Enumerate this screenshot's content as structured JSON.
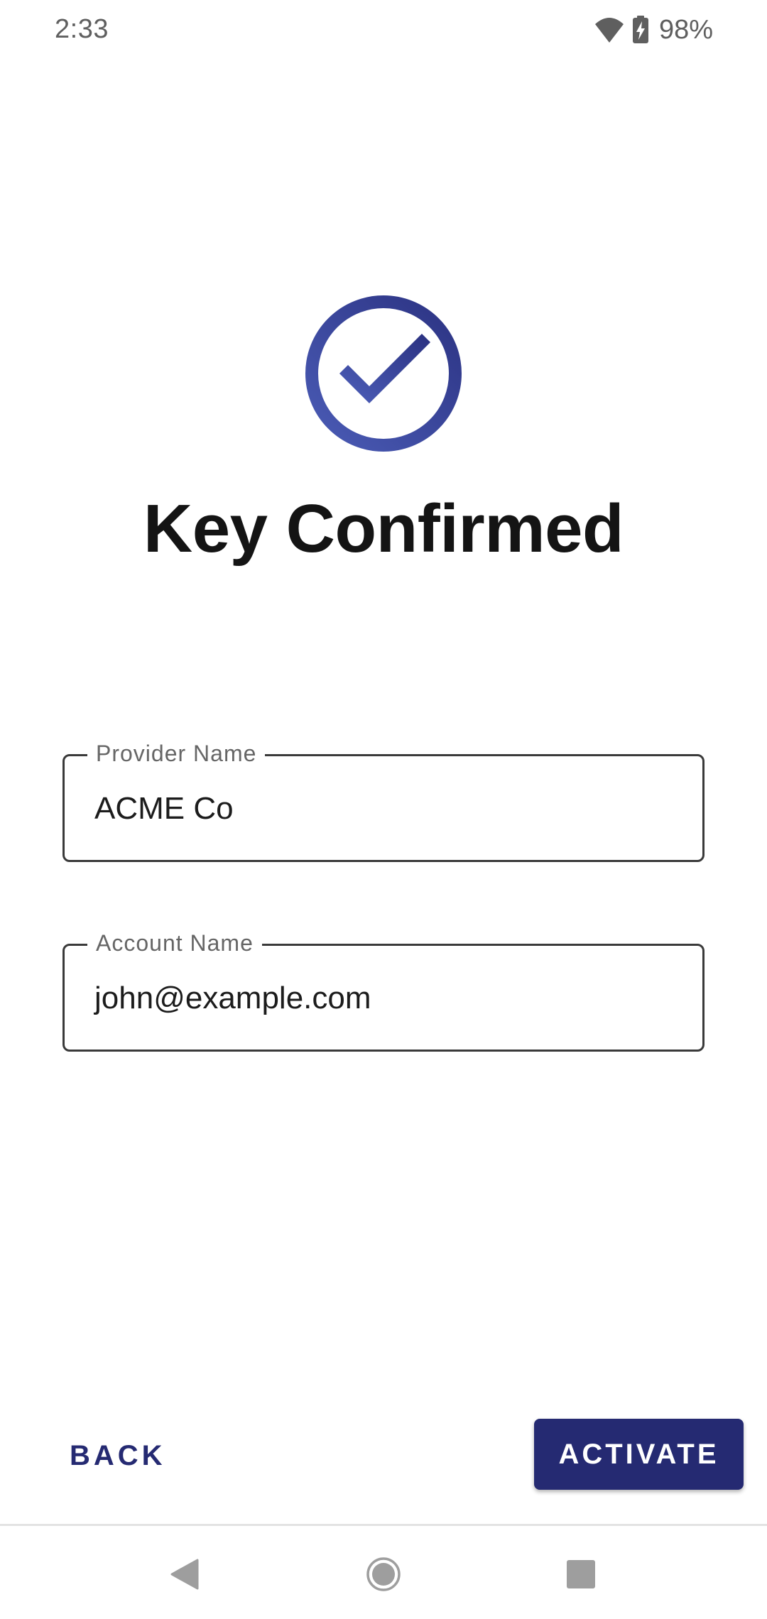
{
  "status_bar": {
    "time": "2:33",
    "battery_percent": "98%",
    "icons": [
      "wifi-icon",
      "battery-charging-icon"
    ]
  },
  "header": {
    "icon": "check-circle-icon",
    "title": "Key Confirmed"
  },
  "form": {
    "provider": {
      "label": "Provider Name",
      "value": "ACME Co"
    },
    "account": {
      "label": "Account Name",
      "value": "john@example.com"
    }
  },
  "actions": {
    "back_label": "BACK",
    "activate_label": "ACTIVATE"
  },
  "nav": {
    "icons": [
      "nav-back-icon",
      "nav-home-icon",
      "nav-recents-icon"
    ]
  },
  "colors": {
    "primary": "#252a72",
    "icon_gradient_start": "#4a5bb5",
    "icon_gradient_end": "#2c3383",
    "nav_icon": "#9e9e9e"
  }
}
